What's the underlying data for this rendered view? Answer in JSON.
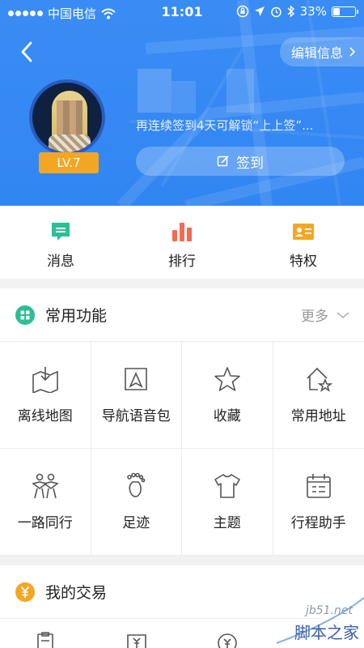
{
  "status_bar": {
    "carrier": "中国电信",
    "time": "11:01",
    "battery": "33%",
    "battery_level": 0.33
  },
  "header": {
    "edit_label": "编辑信息",
    "level": "LV.7",
    "unlock_tip": "再连续签到4天可解锁“上上签”...",
    "sign_label": "签到"
  },
  "quick": [
    {
      "label": "消息",
      "icon": "message-icon",
      "color": "#2bbf95"
    },
    {
      "label": "排行",
      "icon": "ranking-icon",
      "color": "#f26c4f"
    },
    {
      "label": "特权",
      "icon": "privilege-card-icon",
      "color": "#f6a623"
    }
  ],
  "common": {
    "title": "常用功能",
    "more": "更多",
    "icon_color": "#2bbf95",
    "items": [
      {
        "label": "离线地图",
        "icon": "offline-map-icon"
      },
      {
        "label": "导航语音包",
        "icon": "voice-pack-icon"
      },
      {
        "label": "收藏",
        "icon": "star-icon"
      },
      {
        "label": "常用地址",
        "icon": "home-star-icon"
      },
      {
        "label": "一路同行",
        "icon": "companions-icon"
      },
      {
        "label": "足迹",
        "icon": "footprint-icon"
      },
      {
        "label": "主题",
        "icon": "tshirt-icon"
      },
      {
        "label": "行程助手",
        "icon": "calendar-icon"
      }
    ]
  },
  "trade": {
    "title": "我的交易",
    "icon_color": "#f6a623"
  },
  "watermark": {
    "line1": "jb51.net",
    "line2": "脚本之家"
  }
}
